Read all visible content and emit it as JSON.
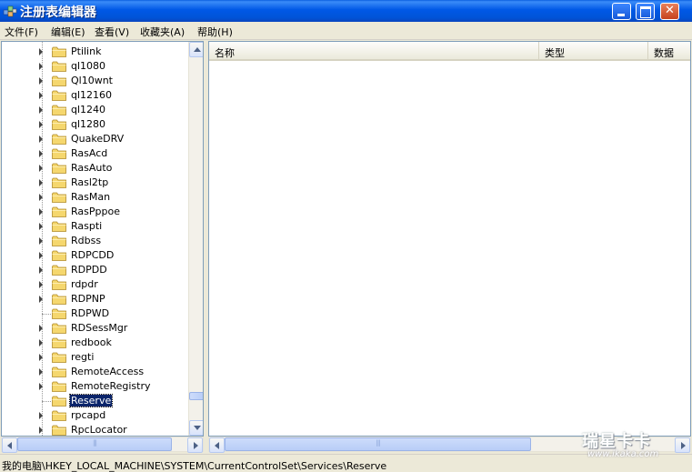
{
  "window": {
    "title": "注册表编辑器"
  },
  "menu": [
    "文件(F)",
    "编辑(E)",
    "查看(V)",
    "收藏夹(A)",
    "帮助(H)"
  ],
  "tree": {
    "items": [
      {
        "label": "Ptilink",
        "expandable": true
      },
      {
        "label": "ql1080",
        "expandable": true
      },
      {
        "label": "Ql10wnt",
        "expandable": true
      },
      {
        "label": "ql12160",
        "expandable": true
      },
      {
        "label": "ql1240",
        "expandable": true
      },
      {
        "label": "ql1280",
        "expandable": true
      },
      {
        "label": "QuakeDRV",
        "expandable": true
      },
      {
        "label": "RasAcd",
        "expandable": true
      },
      {
        "label": "RasAuto",
        "expandable": true
      },
      {
        "label": "Rasl2tp",
        "expandable": true
      },
      {
        "label": "RasMan",
        "expandable": true
      },
      {
        "label": "RasPppoe",
        "expandable": true
      },
      {
        "label": "Raspti",
        "expandable": true
      },
      {
        "label": "Rdbss",
        "expandable": true
      },
      {
        "label": "RDPCDD",
        "expandable": true
      },
      {
        "label": "RDPDD",
        "expandable": true
      },
      {
        "label": "rdpdr",
        "expandable": true
      },
      {
        "label": "RDPNP",
        "expandable": true
      },
      {
        "label": "RDPWD",
        "expandable": false
      },
      {
        "label": "RDSessMgr",
        "expandable": true
      },
      {
        "label": "redbook",
        "expandable": true
      },
      {
        "label": "regti",
        "expandable": true
      },
      {
        "label": "RemoteAccess",
        "expandable": true
      },
      {
        "label": "RemoteRegistry",
        "expandable": true
      },
      {
        "label": "Reserve",
        "expandable": false,
        "selected": true
      },
      {
        "label": "rpcapd",
        "expandable": true
      },
      {
        "label": "RpcLocator",
        "expandable": true
      }
    ]
  },
  "list": {
    "columns": [
      "名称",
      "类型",
      "数据"
    ]
  },
  "status": {
    "path": "我的电脑\\HKEY_LOCAL_MACHINE\\SYSTEM\\CurrentControlSet\\Services\\Reserve"
  },
  "watermark": {
    "title": "瑞星卡卡",
    "url": "www.ikaka.com"
  },
  "colors": {
    "titlebar": "#0058e6",
    "selection": "#0a246a",
    "folder": "#f5d76e"
  }
}
